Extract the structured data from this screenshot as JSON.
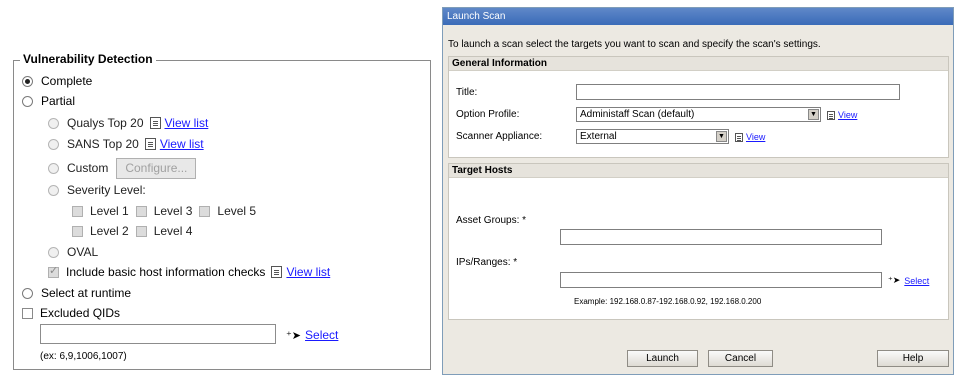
{
  "vuln": {
    "legend": "Vulnerability Detection",
    "complete": "Complete",
    "partial": "Partial",
    "qualys": "Qualys Top 20",
    "sans": "SANS Top 20",
    "view_list": "View list",
    "custom": "Custom",
    "configure": "Configure...",
    "severity": "Severity Level:",
    "levels": [
      "Level 1",
      "Level 3",
      "Level 5",
      "Level 2",
      "Level 4"
    ],
    "oval": "OVAL",
    "include_basic": "Include basic host information checks",
    "select_runtime": "Select at runtime",
    "excluded": "Excluded QIDs",
    "select": "Select",
    "hint": "(ex: 6,9,1006,1007)"
  },
  "dialog": {
    "title": "Launch Scan",
    "intro": "To launch a scan select the targets you want to scan and specify the scan's settings.",
    "general_head": "General Information",
    "title_label": "Title:",
    "option_label": "Option Profile:",
    "option_value": "Administaff Scan (default)",
    "scanner_label": "Scanner Appliance:",
    "scanner_value": "External",
    "view": "View",
    "target_head": "Target Hosts",
    "asset_label": "Asset Groups: *",
    "ips_label": "IPs/Ranges: *",
    "select": "Select",
    "example": "Example: 192.168.0.87-192.168.0.92, 192.168.0.200",
    "buttons": {
      "launch": "Launch",
      "cancel": "Cancel",
      "help": "Help"
    }
  },
  "colors": {
    "link": "#1a1aff",
    "titlebar": "#3a6bb8",
    "dialog_bg": "#ece9e2"
  },
  "icons": [
    "radio-icon",
    "checkbox-icon",
    "document-icon",
    "select-cursor-icon",
    "dropdown-arrow-icon"
  ]
}
